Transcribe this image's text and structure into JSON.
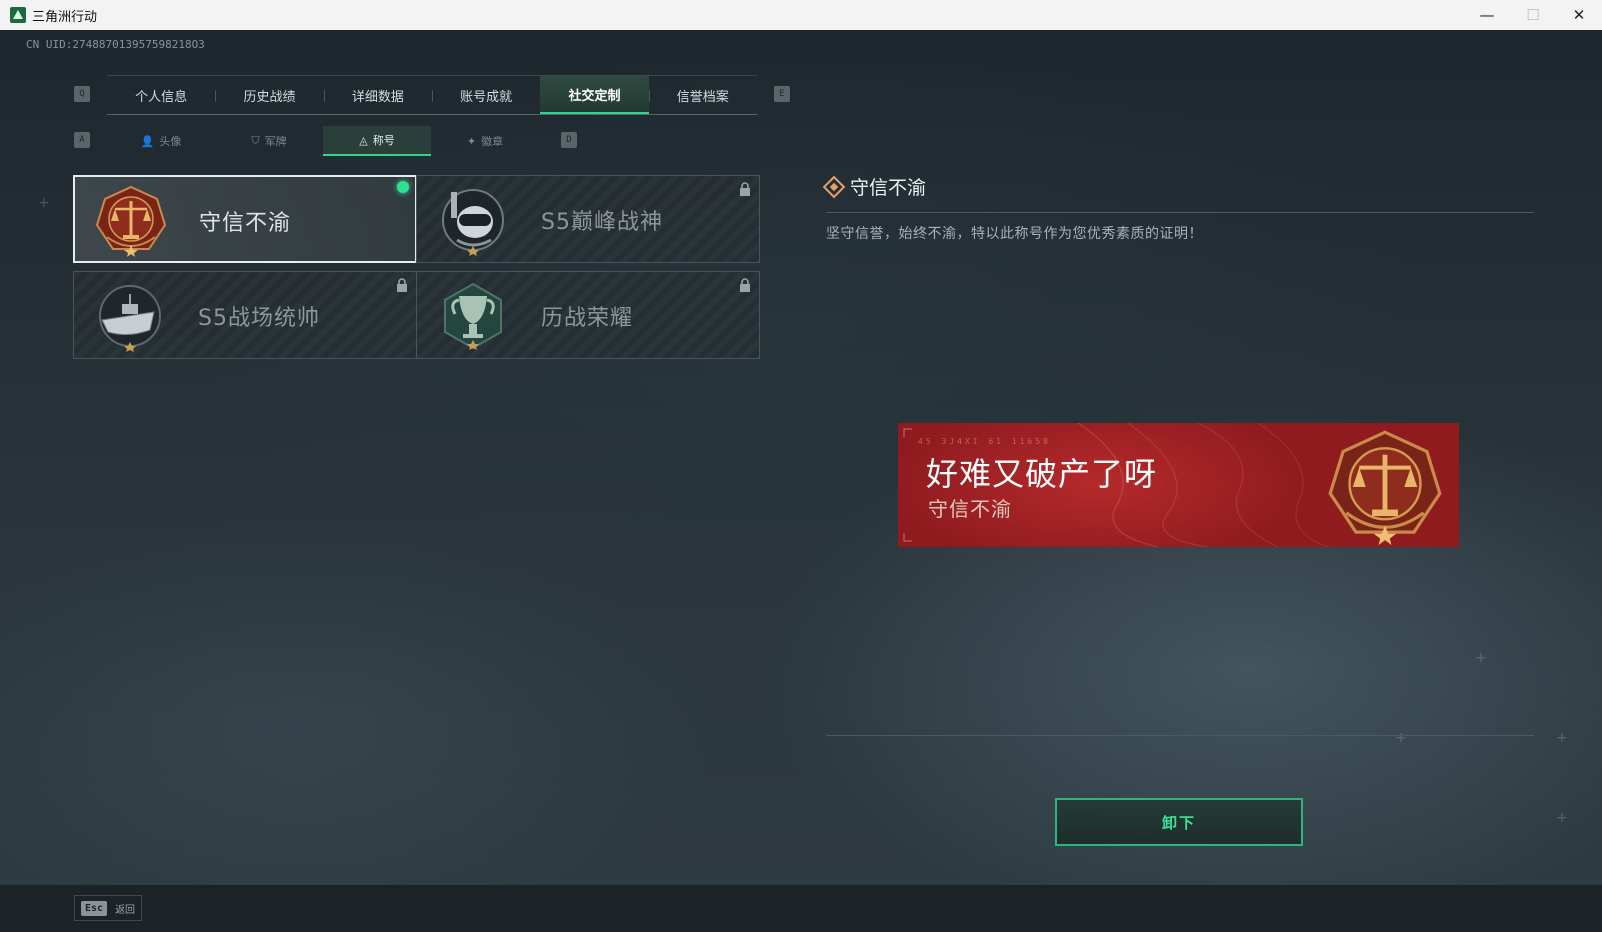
{
  "window": {
    "title": "三角洲行动",
    "minimize": "—",
    "maximize": "☐",
    "close": "✕"
  },
  "uid": "CN UID:274887013957598218O3",
  "tabs": {
    "prev_key": "Q",
    "next_key": "E",
    "items": [
      {
        "label": "个人信息",
        "active": false
      },
      {
        "label": "历史战绩",
        "active": false
      },
      {
        "label": "详细数据",
        "active": false
      },
      {
        "label": "账号成就",
        "active": false
      },
      {
        "label": "社交定制",
        "active": true
      },
      {
        "label": "信誉档案",
        "active": false
      }
    ]
  },
  "subtabs": {
    "prev_key": "A",
    "next_key": "D",
    "items": [
      {
        "label": "头像",
        "icon": "person-icon",
        "glyph": "👤",
        "active": false
      },
      {
        "label": "军牌",
        "icon": "shield-icon",
        "glyph": "⛉",
        "active": false
      },
      {
        "label": "称号",
        "icon": "triangle-icon",
        "glyph": "◬",
        "active": true
      },
      {
        "label": "徽章",
        "icon": "badge-icon",
        "glyph": "✦",
        "active": false
      }
    ]
  },
  "titles": [
    {
      "name": "守信不渝",
      "emblem": "scales-icon",
      "selected": true,
      "equipped": true,
      "locked": false
    },
    {
      "name": "S5巅峰战神",
      "emblem": "diver-skull-icon",
      "selected": false,
      "equipped": false,
      "locked": true
    },
    {
      "name": "S5战场统帅",
      "emblem": "boat-icon",
      "selected": false,
      "equipped": false,
      "locked": true
    },
    {
      "name": "历战荣耀",
      "emblem": "trophy-icon",
      "selected": false,
      "equipped": false,
      "locked": true
    }
  ],
  "detail": {
    "title": "守信不渝",
    "description": "坚守信誉，始终不渝，特以此称号作为您优秀素质的证明！"
  },
  "banner": {
    "nickname": "好难又破产了呀",
    "title": "守信不渝",
    "code": "45 3J4XI  61 11658"
  },
  "actions": {
    "unequip_label": "卸下"
  },
  "footer": {
    "esc_key": "Esc",
    "back_label": "返回"
  },
  "colors": {
    "accent": "#2fd58a",
    "banner_red": "#a82426",
    "emblem_gold": "#d49a52"
  }
}
